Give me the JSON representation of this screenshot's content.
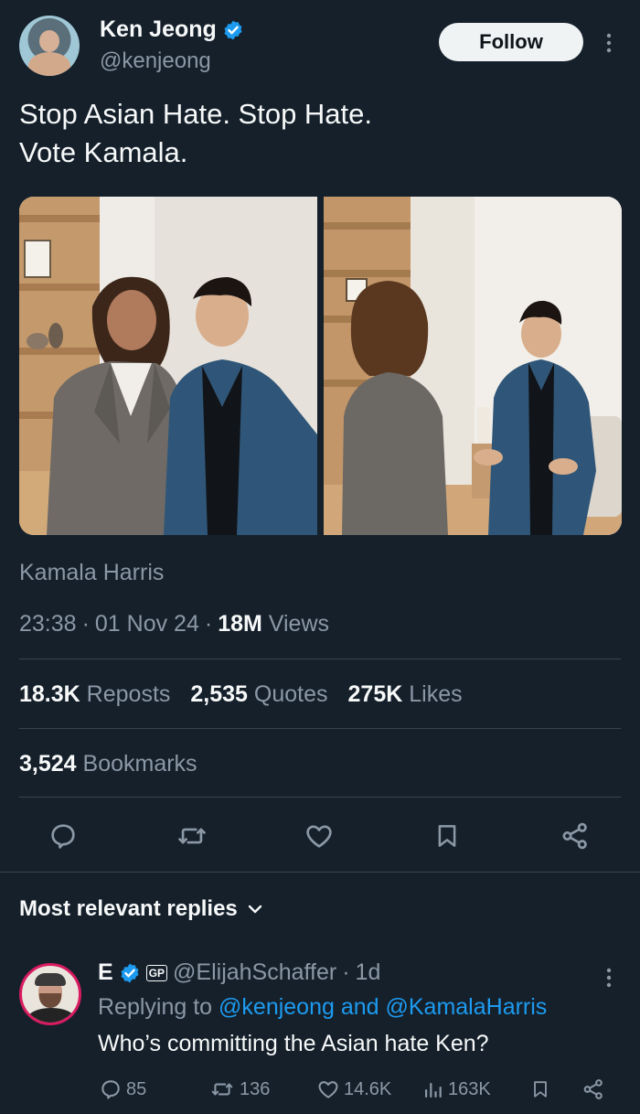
{
  "tweet": {
    "display_name": "Ken Jeong",
    "handle": "@kenjeong",
    "follow_label": "Follow",
    "text_line1": "Stop Asian Hate. Stop Hate.",
    "text_line2": "Vote Kamala.",
    "photo_tag": "Kamala Harris",
    "time": "23:38",
    "date": "01 Nov 24",
    "views_count": "18M",
    "views_label": "Views",
    "sep": "·"
  },
  "stats": {
    "reposts_count": "18.3K",
    "reposts_label": "Reposts",
    "quotes_count": "2,535",
    "quotes_label": "Quotes",
    "likes_count": "275K",
    "likes_label": "Likes",
    "bookmarks_count": "3,524",
    "bookmarks_label": "Bookmarks"
  },
  "actions": [
    "reply-icon",
    "repost-icon",
    "like-icon",
    "bookmark-icon",
    "share-icon"
  ],
  "replies_header": "Most relevant replies",
  "reply": {
    "name": "E",
    "badge": "GP",
    "handle": "@ElijahSchaffer",
    "age": "1d",
    "sep": "·",
    "replying_prefix": "Replying to",
    "replying_to": "@kenjeong and @KamalaHarris",
    "text": "Who’s committing the Asian hate Ken?",
    "replies": "85",
    "reposts": "136",
    "likes": "14.6K",
    "views": "163K"
  },
  "colors": {
    "background": "#15202b",
    "verified": "#1d9bf0",
    "secondary_text": "#8b98a5",
    "link": "#1d9bf0",
    "divider": "#38444d"
  }
}
